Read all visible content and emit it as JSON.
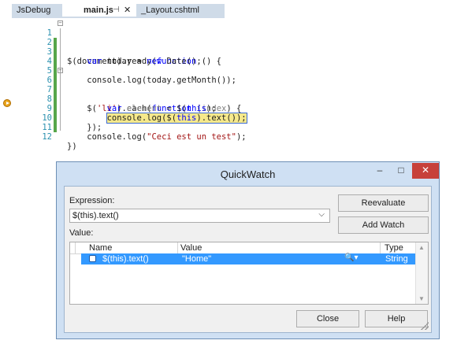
{
  "tabs": [
    {
      "label": "JsDebug",
      "active": false
    },
    {
      "label": "main.js",
      "active": true,
      "pin": "⊣",
      "close": "✕"
    },
    {
      "label": "_Layout.cshtml",
      "active": false
    }
  ],
  "editor": {
    "lines": [
      {
        "num": "1",
        "text": "$(document).ready(function () {"
      },
      {
        "num": "2",
        "text": "    var today = new Date();"
      },
      {
        "num": "3",
        "text": ""
      },
      {
        "num": "4",
        "text": "    console.log(today.getMonth());"
      },
      {
        "num": "5",
        "text": ""
      },
      {
        "num": "6",
        "text": "    $('li').each(function (index) {"
      },
      {
        "num": "7",
        "text": "        var element = $(this);"
      },
      {
        "num": "8",
        "text": "        console.log($(this).text());"
      },
      {
        "num": "9",
        "text": "    });"
      },
      {
        "num": "10",
        "text": ""
      },
      {
        "num": "11",
        "text": "    console.log(\"Ceci est un test\");"
      },
      {
        "num": "12",
        "text": "})"
      }
    ],
    "breakpoint_line": "8"
  },
  "quickwatch": {
    "title": "QuickWatch",
    "min_glyph": "–",
    "max_glyph": "□",
    "close_glyph": "✕",
    "expression_label": "Expression:",
    "expression_value": "$(this).text()",
    "value_label": "Value:",
    "reevaluate": "Reevaluate",
    "add_watch": "Add Watch",
    "close": "Close",
    "help": "Help",
    "columns": {
      "name": "Name",
      "value": "Value",
      "type": "Type"
    },
    "rows": [
      {
        "name": "$(this).text()",
        "value": "\"Home\"",
        "type": "String",
        "selected": true
      }
    ]
  },
  "colors": {
    "selection": "#3399ff",
    "close_button": "#c7413a",
    "changed_margin": "#57a64a",
    "breakpoint": "#e8a31c"
  }
}
